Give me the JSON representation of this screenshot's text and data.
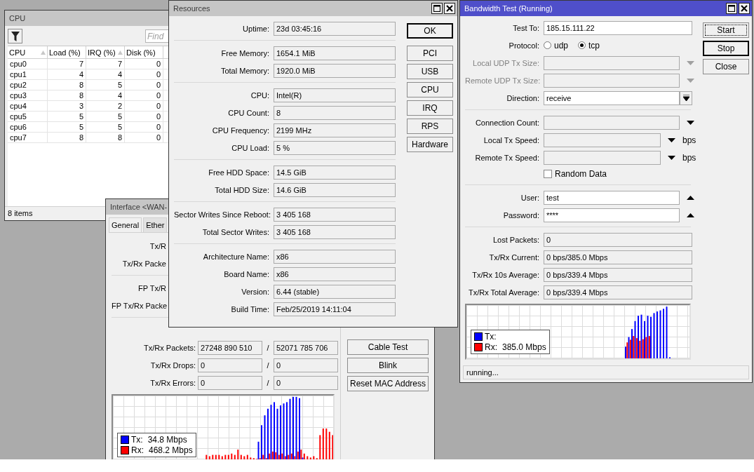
{
  "cpu_window": {
    "title": "CPU",
    "active": false,
    "search": {
      "placeholder": "Find"
    },
    "table": {
      "columns": [
        {
          "label": "CPU",
          "sorted": true
        },
        {
          "label": "Load (%)",
          "sorted": false
        },
        {
          "label": "IRQ (%)",
          "sorted": true
        },
        {
          "label": "Disk (%)",
          "sorted": false
        }
      ],
      "rows": [
        [
          "cpu0",
          "7",
          "7",
          "0"
        ],
        [
          "cpu1",
          "4",
          "4",
          "0"
        ],
        [
          "cpu2",
          "8",
          "5",
          "0"
        ],
        [
          "cpu3",
          "8",
          "4",
          "0"
        ],
        [
          "cpu4",
          "3",
          "2",
          "0"
        ],
        [
          "cpu5",
          "5",
          "5",
          "0"
        ],
        [
          "cpu6",
          "5",
          "5",
          "0"
        ],
        [
          "cpu7",
          "8",
          "8",
          "0"
        ]
      ]
    },
    "status_bar": "8 items"
  },
  "interface_window": {
    "title": "Interface <WAN-",
    "active": false,
    "tabs": [
      {
        "label": "General",
        "selected": true
      },
      {
        "label": "Ether",
        "selected": false
      }
    ],
    "upper_groups": [
      [
        "Tx/R",
        "Tx/Rx Packe"
      ],
      [
        "FP Tx/R",
        "FP Tx/Rx Packe"
      ]
    ],
    "rows": [
      {
        "label": "Tx/Rx Packets:",
        "tx": "27248 890 510",
        "separator": "/",
        "rx": "52071 785 706"
      },
      {
        "label": "Tx/Rx Drops:",
        "tx": "0",
        "separator": "/",
        "rx": "0"
      },
      {
        "label": "Tx/Rx Errors:",
        "tx": "0",
        "separator": "/",
        "rx": "0"
      }
    ],
    "buttons": [
      "Cable Test",
      "Blink",
      "Reset MAC Address"
    ],
    "legend": [
      {
        "label": "Tx:",
        "value": "34.8 Mbps",
        "color": "#0000ff"
      },
      {
        "label": "Rx:",
        "value": "468.2 Mbps",
        "color": "#ff0000"
      }
    ]
  },
  "resources_window": {
    "title": "Resources",
    "active": false,
    "groups": [
      [
        {
          "label": "Uptime:",
          "value": "23d 03:45:16"
        }
      ],
      [
        {
          "label": "Free Memory:",
          "value": "1654.1 MiB"
        },
        {
          "label": "Total Memory:",
          "value": "1920.0 MiB"
        }
      ],
      [
        {
          "label": "CPU:",
          "value": "Intel(R)"
        },
        {
          "label": "CPU Count:",
          "value": "8"
        },
        {
          "label": "CPU Frequency:",
          "value": "2199 MHz"
        },
        {
          "label": "CPU Load:",
          "value": "5 %"
        }
      ],
      [
        {
          "label": "Free HDD Space:",
          "value": "14.5 GiB"
        },
        {
          "label": "Total HDD Size:",
          "value": "14.6 GiB"
        }
      ],
      [
        {
          "label": "Sector Writes Since Reboot:",
          "value": "3 405 168"
        },
        {
          "label": "Total Sector Writes:",
          "value": "3 405 168"
        }
      ],
      [
        {
          "label": "Architecture Name:",
          "value": "x86"
        },
        {
          "label": "Board Name:",
          "value": "x86"
        },
        {
          "label": "Version:",
          "value": "6.44 (stable)"
        },
        {
          "label": "Build Time:",
          "value": "Feb/25/2019 14:11:04"
        }
      ]
    ],
    "buttons": [
      {
        "label": "OK",
        "default": true
      },
      {
        "label": "PCI",
        "default": false
      },
      {
        "label": "USB",
        "default": false
      },
      {
        "label": "CPU",
        "default": false
      },
      {
        "label": "IRQ",
        "default": false
      },
      {
        "label": "RPS",
        "default": false
      },
      {
        "label": "Hardware",
        "default": false
      }
    ]
  },
  "bandwidth_window": {
    "title": "Bandwidth Test (Running)",
    "active": true,
    "groups": [
      [
        {
          "kind": "input",
          "label": "Test To:",
          "value": "185.15.111.22"
        },
        {
          "kind": "radio",
          "label": "Protocol:",
          "options": [
            {
              "label": "udp",
              "selected": false
            },
            {
              "label": "tcp",
              "selected": true
            }
          ]
        },
        {
          "kind": "dropdown",
          "label": "Local UDP Tx Size:",
          "disabled": true
        },
        {
          "kind": "dropdown",
          "label": "Remote UDP Tx Size:",
          "disabled": true
        },
        {
          "kind": "select",
          "label": "Direction:",
          "value": "receive"
        }
      ],
      [
        {
          "kind": "dropdown",
          "label": "Connection Count:",
          "disabled": false
        },
        {
          "kind": "speed",
          "label": "Local Tx Speed:",
          "unit": "bps"
        },
        {
          "kind": "speed",
          "label": "Remote Tx Speed:",
          "unit": "bps"
        },
        {
          "kind": "checkbox",
          "label": "Random Data",
          "checked": false
        }
      ],
      [
        {
          "kind": "collapsible",
          "label": "User:",
          "value": "test"
        },
        {
          "kind": "collapsible",
          "label": "Password:",
          "value": "****"
        }
      ],
      [
        {
          "kind": "output",
          "label": "Lost Packets:",
          "value": "0"
        },
        {
          "kind": "output",
          "label": "Tx/Rx Current:",
          "value": "0 bps/385.0 Mbps"
        },
        {
          "kind": "output",
          "label": "Tx/Rx 10s Average:",
          "value": "0 bps/339.4 Mbps"
        },
        {
          "kind": "output",
          "label": "Tx/Rx Total Average:",
          "value": "0 bps/339.4 Mbps"
        }
      ]
    ],
    "buttons": [
      {
        "label": "Start",
        "kind": "focused"
      },
      {
        "label": "Stop",
        "kind": "default"
      },
      {
        "label": "Close",
        "kind": "plain"
      }
    ],
    "legend": [
      {
        "label": "Tx:",
        "color": "#0000ff"
      },
      {
        "label": "Rx:",
        "value": "385.0 Mbps",
        "color": "#ff0000"
      }
    ],
    "status_bar": "running..."
  }
}
